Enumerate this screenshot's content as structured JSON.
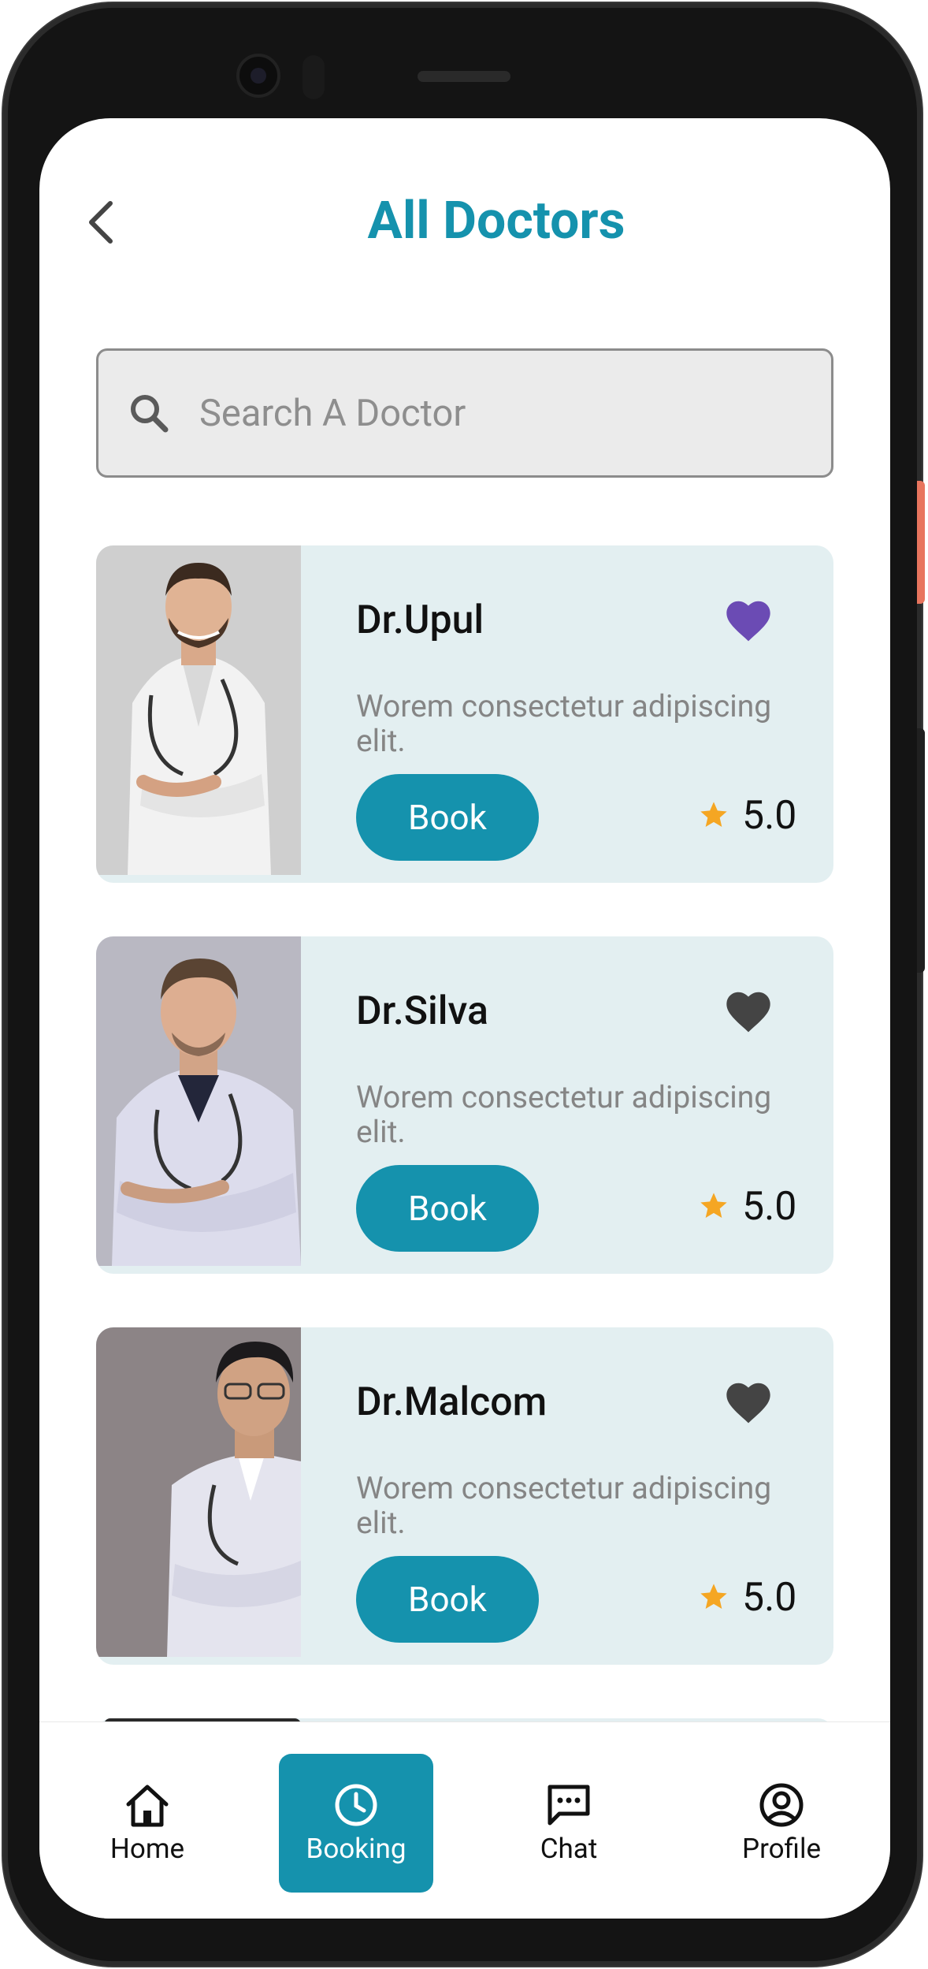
{
  "header": {
    "title": "All Doctors"
  },
  "search": {
    "placeholder": "Search A Doctor"
  },
  "doctors": [
    {
      "name": "Dr.Upul",
      "description": "Worem consectetur adipiscing elit.",
      "book_label": "Book",
      "rating": "5.0",
      "favorite": true
    },
    {
      "name": "Dr.Silva",
      "description": "Worem consectetur adipiscing elit.",
      "book_label": "Book",
      "rating": "5.0",
      "favorite": false
    },
    {
      "name": "Dr.Malcom",
      "description": "Worem consectetur adipiscing elit.",
      "book_label": "Book",
      "rating": "5.0",
      "favorite": false
    }
  ],
  "nav": {
    "items": [
      {
        "label": "Home",
        "icon": "home-icon",
        "active": false
      },
      {
        "label": "Booking",
        "icon": "clock-icon",
        "active": true
      },
      {
        "label": "Chat",
        "icon": "chat-icon",
        "active": false
      },
      {
        "label": "Profile",
        "icon": "profile-icon",
        "active": false
      }
    ]
  },
  "colors": {
    "accent": "#1592ad",
    "card_background": "#e3eff1",
    "heart_favorite": "#6b4bb4",
    "heart_default": "#444444",
    "star": "#f5a623"
  }
}
